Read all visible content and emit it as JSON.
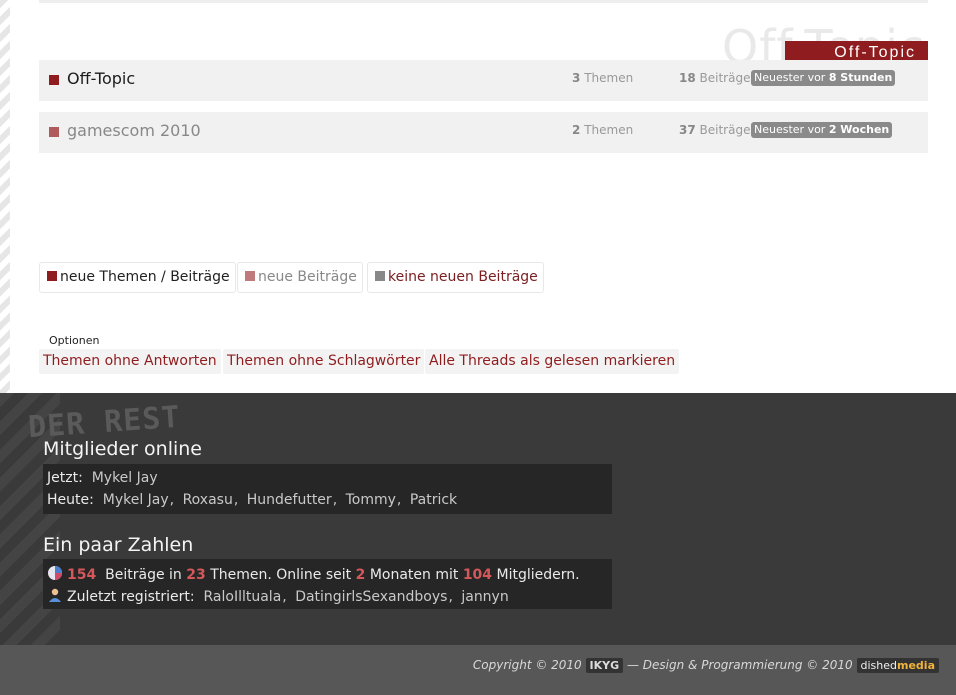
{
  "category": {
    "ghost_title": "Off-Topic",
    "ribbon_label": "Off-Topic",
    "accent_color": "#8f1d1f"
  },
  "forums": [
    {
      "title": "Off-Topic",
      "threads_count": "3",
      "threads_label": "Themen",
      "posts_count": "18",
      "posts_label": "Beiträge",
      "newest_prefix": "Neuester vor",
      "newest_value": "8 Stunden",
      "status_color": "#8f1d1f"
    },
    {
      "title": "gamescom 2010",
      "threads_count": "2",
      "threads_label": "Themen",
      "posts_count": "37",
      "posts_label": "Beiträge",
      "newest_prefix": "Neuester vor",
      "newest_value": "2 Wochen",
      "status_color": "#b05a5c"
    }
  ],
  "legend": [
    {
      "label": "neue Themen / Beiträge",
      "color": "#8f1d1f"
    },
    {
      "label": "neue Beiträge",
      "color": "#c07a7c"
    },
    {
      "label": "keine neuen Beiträge",
      "color": "#888888"
    }
  ],
  "options": {
    "heading": "Optionen",
    "links": [
      "Themen ohne Antworten",
      "Themen ohne Schlagwörter",
      "Alle Threads als gelesen markieren"
    ]
  },
  "footer": {
    "section_logo": "DER REST",
    "online": {
      "heading": "Mitglieder online",
      "now_label": "Jetzt:",
      "now_users": [
        "Mykel Jay"
      ],
      "today_label": "Heute:",
      "today_users": [
        "Mykel Jay",
        "Roxasu",
        "Hundefutter",
        "Tommy",
        "Patrick"
      ]
    },
    "stats": {
      "heading": "Ein paar Zahlen",
      "posts": "154",
      "posts_text": "Beiträge in",
      "threads": "23",
      "threads_text": "Themen. Online seit",
      "months": "2",
      "months_text": "Monaten mit",
      "members": "104",
      "members_text": "Mitgliedern.",
      "registered_label": "Zuletzt registriert:",
      "registered_users": [
        "RaloIlltuala",
        "DatingirlsSexandboys",
        "jannyn"
      ]
    }
  },
  "copyright": {
    "prefix": "Copyright © 2010",
    "brand": "IKYG",
    "middle": "— Design & Programmierung © 2010",
    "studio_a": "dished",
    "studio_b": "media"
  }
}
